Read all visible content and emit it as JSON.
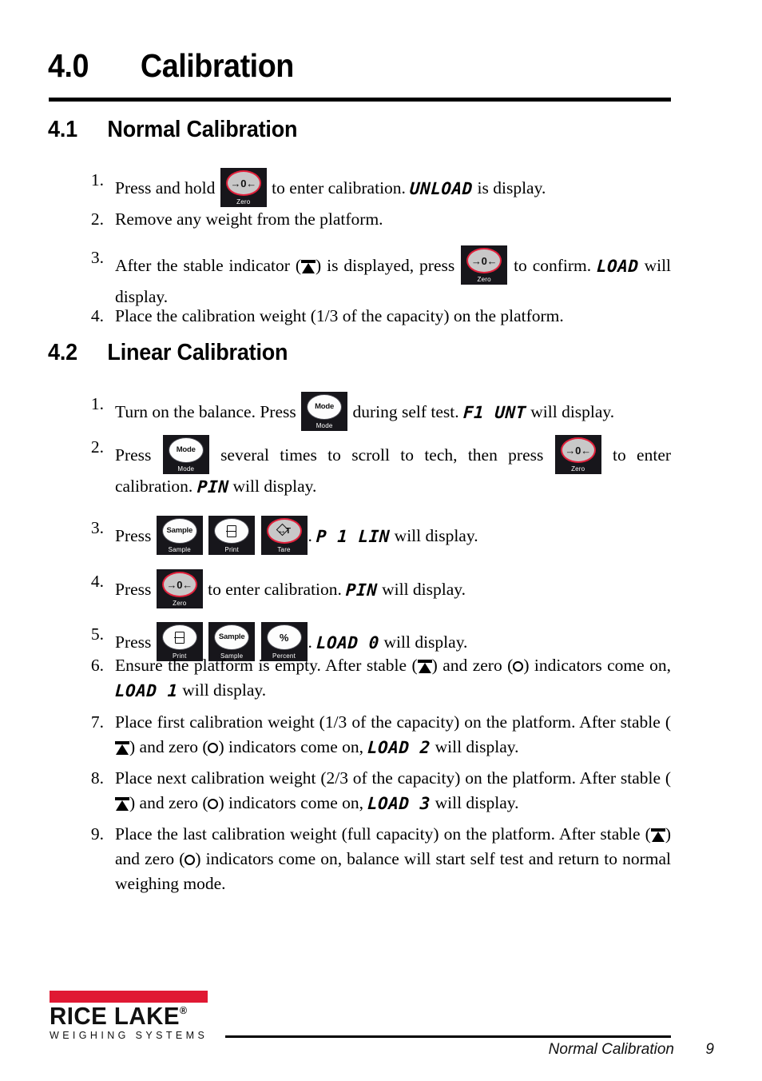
{
  "document": {
    "chapter_number": "4.0",
    "chapter_title": "Calibration",
    "sections": [
      {
        "number": "4.1",
        "title": "Normal Calibration"
      },
      {
        "number": "4.2",
        "title": "Linear Calibration"
      }
    ]
  },
  "keys": {
    "zero": {
      "label": "Zero",
      "cap": "→0←",
      "style": "gray"
    },
    "mode": {
      "label": "Mode",
      "cap": "Mode",
      "style": "light"
    },
    "sample": {
      "label": "Sample",
      "cap": "Sample",
      "style": "light"
    },
    "print": {
      "label": "Print",
      "cap": "printer-icon",
      "style": "light"
    },
    "tare": {
      "label": "Tare",
      "cap": "↔T",
      "style": "gray"
    },
    "percent": {
      "label": "Percent",
      "cap": "%",
      "style": "light"
    }
  },
  "indicators": {
    "stable_name": "stable-indicator",
    "zero_name": "zero-indicator"
  },
  "normal_calibration": {
    "items": [
      {
        "num": "1.",
        "t1": "Press and hold",
        "t2": "to enter calibration.",
        "lcd": "UNLOAD",
        "t3": "is display."
      },
      {
        "num": "2.",
        "t1": "Remove any weight from the platform."
      },
      {
        "num": "3.",
        "t1": "After the stable indicator (",
        "t2": ") is displayed, press",
        "t3": "to confirm.",
        "lcd": "LOAD",
        "t4": "will display."
      },
      {
        "num": "4.",
        "t1": "Place the calibration weight (1/3 of the capacity) on the platform."
      }
    ]
  },
  "linear_calibration": {
    "items": [
      {
        "num": "1.",
        "t1": "Turn on the balance. Press",
        "t2": "during self test.",
        "lcd": "F1 UNT",
        "t3": "will display."
      },
      {
        "num": "2.",
        "t1": "Press",
        "t2": "several times to scroll to tech, then press",
        "t3": "to enter calibration.",
        "lcd": "PIN",
        "t4": "will display."
      },
      {
        "num": "3.",
        "t1": "Press",
        "t2": ".",
        "lcd": "P 1 LIN",
        "t3": "will display."
      },
      {
        "num": "4.",
        "t1": "Press",
        "t2": "to enter calibration.",
        "lcd": "PIN",
        "t3": "will display."
      },
      {
        "num": "5.",
        "t1": "Press",
        "t2": ".",
        "lcd": "LOAD 0",
        "t3": "will display."
      },
      {
        "num": "6.",
        "t1": "Ensure the platform is empty. After stable (",
        "t2": ") and zero (",
        "t3": ") indicators come on,",
        "lcd": "LOAD 1",
        "t4": "will display."
      },
      {
        "num": "7.",
        "t1": "Place first calibration weight (1/3 of the capacity) on the platform. After stable (",
        "t2": ") and zero (",
        "t3": ") indicators come on,",
        "lcd": "LOAD 2",
        "t4": "will display."
      },
      {
        "num": "8.",
        "t1": "Place next calibration weight (2/3 of the capacity) on the platform. After stable (",
        "t2": ") and zero (",
        "t3": ") indicators come on,",
        "lcd": "LOAD 3",
        "t4": "will display."
      },
      {
        "num": "9.",
        "t1": "Place the last calibration weight (full capacity) on the platform. After stable (",
        "t2": ") and zero (",
        "t3": ") indicators come on, balance will start self test and return to normal weighing mode."
      }
    ]
  },
  "footer": {
    "logo_name": "RICE LAKE",
    "logo_registered": "®",
    "logo_tagline": "WEIGHING SYSTEMS",
    "section_name": "Normal Calibration",
    "page_number": "9",
    "brand_red": "#E01933"
  }
}
